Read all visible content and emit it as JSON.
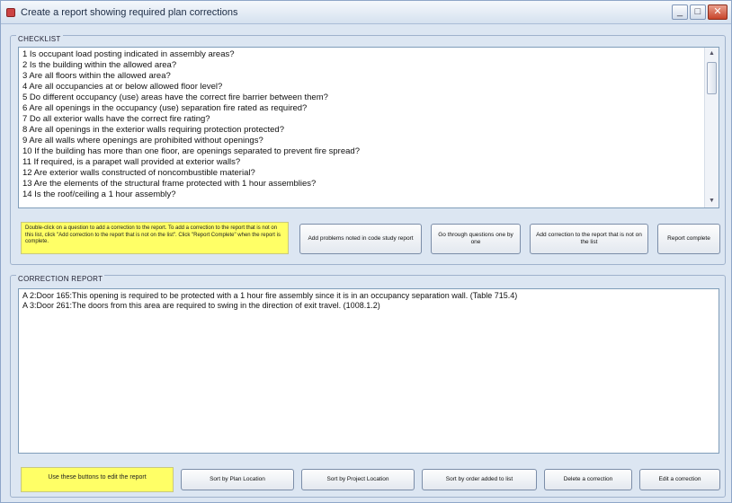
{
  "window": {
    "title": "Create a report showing required plan corrections",
    "controls": {
      "minimize": "_",
      "maximize": "□",
      "close": "✕"
    }
  },
  "checklist": {
    "label": "CHECKLIST",
    "items": [
      "1  Is occupant load posting indicated in assembly areas?",
      "2  Is the building within the allowed area?",
      "3  Are all floors within the allowed area?",
      "4  Are all occupancies at or below allowed floor level?",
      "5  Do different occupancy (use) areas have the correct fire barrier between them?",
      "6  Are all openings in the occupancy (use) separation fire rated as required?",
      "7  Do all exterior walls have the correct fire rating?",
      "8  Are all openings in the exterior walls requiring protection protected?",
      "9  Are all walls where openings are prohibited without openings?",
      "10  If the building has more than one floor, are openings separated to prevent fire spread?",
      "11  If required, is a parapet wall provided at exterior walls?",
      "12  Are exterior walls constructed of noncombustible material?",
      "13  Are the elements of the structural frame protected with 1 hour assemblies?",
      "14  Is the roof/ceiling a 1 hour assembly?"
    ],
    "note": "Double-click on a question to add a correction to the report. To add a correction to the report that is not on this list, click \"Add correction to the report that is not on the list\". Click \"Report Complete\" when the report is complete.",
    "buttons": {
      "add_problems": "Add problems noted in code study report",
      "go_through": "Go through questions one by one",
      "add_correction": "Add correction to the report that is not on the list",
      "report_complete": "Report complete"
    }
  },
  "report": {
    "label": "CORRECTION REPORT",
    "lines": [
      "A 2:Door 165:This opening is required to be protected with a 1 hour fire assembly since it is in an occupancy separation wall. (Table 715.4)",
      "A 3:Door 261:The doors from this area are required to swing in the direction of exit travel. (1008.1.2)"
    ],
    "note": "Use these buttons to edit the report",
    "buttons": {
      "sort_plan": "Sort by Plan Location",
      "sort_project": "Sort by Project Location",
      "sort_order": "Sort by order added to list",
      "delete": "Delete a correction",
      "edit": "Edit a correction"
    }
  }
}
